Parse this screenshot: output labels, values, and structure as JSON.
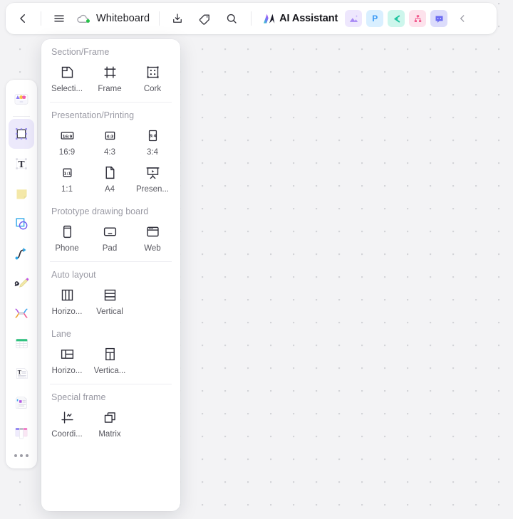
{
  "app": {
    "title": "Whiteboard",
    "accent": "#7b61ff",
    "canvas_bg": "#f3f3f5",
    "dot_color": "#d3d4d8"
  },
  "topbar": {
    "back_label": "Back",
    "menu_label": "Menu",
    "cloud_status_label": "Saved to cloud",
    "doc_title": "Whiteboard",
    "export_label": "Export",
    "tag_label": "Tag",
    "search_label": "Search",
    "ai_assistant_label": "AI Assistant",
    "collapse_label": "Collapse",
    "apps": [
      {
        "name": "image-app",
        "glyph": "",
        "bg": "#eee7fd",
        "fg": "#a889f5"
      },
      {
        "name": "presentation-app",
        "glyph": "P",
        "bg": "#d9efff",
        "fg": "#3d9bf5"
      },
      {
        "name": "mindmap-app",
        "glyph": "C",
        "bg": "#cdf6ec",
        "fg": "#1fc4a0"
      },
      {
        "name": "flowchart-app",
        "glyph": "",
        "bg": "#fde2ec",
        "fg": "#f25b8e"
      },
      {
        "name": "comment-app",
        "glyph": "",
        "bg": "#dcdcfb",
        "fg": "#6b6bf2"
      }
    ]
  },
  "left_toolbar": {
    "items": [
      {
        "name": "templates",
        "label": "Templates",
        "active": false
      },
      {
        "name": "frame",
        "label": "Frame",
        "active": true
      },
      {
        "name": "text",
        "label": "Text",
        "active": false
      },
      {
        "name": "sticky-note",
        "label": "Sticky note",
        "active": false
      },
      {
        "name": "shape",
        "label": "Shape",
        "active": false
      },
      {
        "name": "connector",
        "label": "Connector",
        "active": false
      },
      {
        "name": "pen",
        "label": "Pen",
        "active": false
      },
      {
        "name": "mindmap",
        "label": "Mind map",
        "active": false
      },
      {
        "name": "table",
        "label": "Table",
        "active": false
      },
      {
        "name": "document",
        "label": "Document",
        "active": false
      },
      {
        "name": "card",
        "label": "Card",
        "active": false
      },
      {
        "name": "kanban",
        "label": "Kanban",
        "active": false
      }
    ],
    "more_label": "More"
  },
  "panel": {
    "sections": [
      {
        "title": "Section/Frame",
        "items": [
          {
            "name": "section-selection",
            "label": "Selecti...",
            "full": "Selection",
            "icon": "selection-icon"
          },
          {
            "name": "section-frame",
            "label": "Frame",
            "full": "Frame",
            "icon": "frame-icon"
          },
          {
            "name": "section-cork",
            "label": "Cork",
            "full": "Cork",
            "icon": "cork-icon"
          }
        ],
        "divider_after": true
      },
      {
        "title": "Presentation/Printing",
        "items": [
          {
            "name": "ratio-16-9",
            "label": "16:9",
            "full": "16:9",
            "icon": "ratio-16-9-icon"
          },
          {
            "name": "ratio-4-3",
            "label": "4:3",
            "full": "4:3",
            "icon": "ratio-4-3-icon"
          },
          {
            "name": "ratio-3-4",
            "label": "3:4",
            "full": "3:4",
            "icon": "ratio-3-4-icon"
          },
          {
            "name": "ratio-1-1",
            "label": "1:1",
            "full": "1:1",
            "icon": "ratio-1-1-icon"
          },
          {
            "name": "paper-a4",
            "label": "A4",
            "full": "A4",
            "icon": "a4-icon"
          },
          {
            "name": "presentation",
            "label": "Presen...",
            "full": "Presentation",
            "icon": "presentation-icon"
          }
        ],
        "divider_after": false
      },
      {
        "title": "Prototype drawing board",
        "items": [
          {
            "name": "device-phone",
            "label": "Phone",
            "full": "Phone",
            "icon": "phone-icon"
          },
          {
            "name": "device-pad",
            "label": "Pad",
            "full": "Pad",
            "icon": "pad-icon"
          },
          {
            "name": "device-web",
            "label": "Web",
            "full": "Web",
            "icon": "web-icon"
          }
        ],
        "divider_after": true
      },
      {
        "title": "Auto layout",
        "items": [
          {
            "name": "autolayout-horizontal",
            "label": "Horizo...",
            "full": "Horizontal",
            "icon": "layout-horizontal-icon"
          },
          {
            "name": "autolayout-vertical",
            "label": "Vertical",
            "full": "Vertical",
            "icon": "layout-vertical-icon"
          }
        ],
        "divider_after": false
      },
      {
        "title": "Lane",
        "items": [
          {
            "name": "lane-horizontal",
            "label": "Horizo...",
            "full": "Horizontal",
            "icon": "lane-horizontal-icon"
          },
          {
            "name": "lane-vertical",
            "label": "Vertica...",
            "full": "Vertical",
            "icon": "lane-vertical-icon"
          }
        ],
        "divider_after": true
      },
      {
        "title": "Special frame",
        "items": [
          {
            "name": "coordinate",
            "label": "Coordi...",
            "full": "Coordinate",
            "icon": "coordinate-icon"
          },
          {
            "name": "matrix",
            "label": "Matrix",
            "full": "Matrix",
            "icon": "matrix-icon"
          }
        ],
        "divider_after": false
      }
    ]
  }
}
